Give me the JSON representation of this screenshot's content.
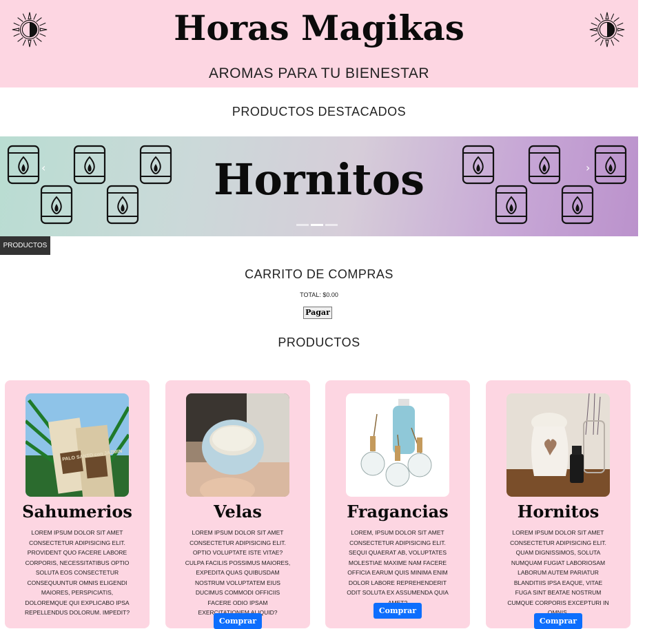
{
  "header": {
    "brand": "Horas Magikas",
    "tagline": "AROMAS PARA TU BIENESTAR",
    "sun_icon": "sun-moon-icon"
  },
  "featured": {
    "title": "PRODUCTOS DESTACADOS",
    "slide_title": "Hornitos",
    "prev_symbol": "‹",
    "next_symbol": "›",
    "active_slide": 2,
    "slide_count": 3
  },
  "nav": {
    "products_tab": "PRODUCTOS"
  },
  "cart": {
    "title": "CARRITO DE COMPRAS",
    "total": "TOTAL: $0.00",
    "pay_label": "Pagar"
  },
  "products_section": {
    "title": "PRODUCTOS"
  },
  "products": [
    {
      "name": "Sahumerios",
      "description": "LOREM IPSUM DOLOR SIT AMET CONSECTETUR ADIPISICING ELIT. PROVIDENT QUO FACERE LABORE CORPORIS, NECESSITATIBUS OPTIO SOLUTA EOS CONSECTETUR CONSEQUUNTUR OMNIS ELIGENDI MAIORES, PERSPICIATIS, DOLOREMQUE QUI EXPLICABO IPSA REPELLENDUS DOLORUM. IMPEDIT?",
      "buy_label": "Comprar",
      "image_text": "PALO SANTO con JAZMIN"
    },
    {
      "name": "Velas",
      "description": "LOREM IPSUM DOLOR SIT AMET CONSECTETUR ADIPISICING ELIT. OPTIO VOLUPTATE ISTE VITAE? CULPA FACILIS POSSIMUS MAIORES, EXPEDITA QUAS QUIBUSDAM NOSTRUM VOLUPTATEM EIUS DUCIMUS COMMODI OFFICIIS FACERE ODIO IPSAM EXERCITATIONEM ALIQUID?",
      "buy_label": "Comprar"
    },
    {
      "name": "Fragancias",
      "description": "LOREM, IPSUM DOLOR SIT AMET CONSECTETUR ADIPISICING ELIT. SEQUI QUAERAT AB, VOLUPTATES MOLESTIAE MAXIME NAM FACERE OFFICIA EARUM QUIS MINIMA ENIM DOLOR LABORE REPREHENDERIT ODIT SOLUTA EX ASSUMENDA QUIA AMET?",
      "buy_label": "Comprar"
    },
    {
      "name": "Hornitos",
      "description": "LOREM IPSUM DOLOR SIT AMET CONSECTETUR ADIPISICING ELIT. QUAM DIGNISSIMOS, SOLUTA NUMQUAM FUGIAT LABORIOSAM LABORUM AUTEM PARIATUR BLANDITIIS IPSA EAQUE, VITAE FUGA SINT BEATAE NOSTRUM CUMQUE CORPORIS EXCEPTURI IN OMNIS.",
      "buy_label": "Comprar"
    }
  ],
  "colors": {
    "header_bg": "#fdd6e2",
    "card_bg": "#fdd6e2",
    "button_blue": "#0d6efd",
    "tab_bg": "#333333"
  }
}
